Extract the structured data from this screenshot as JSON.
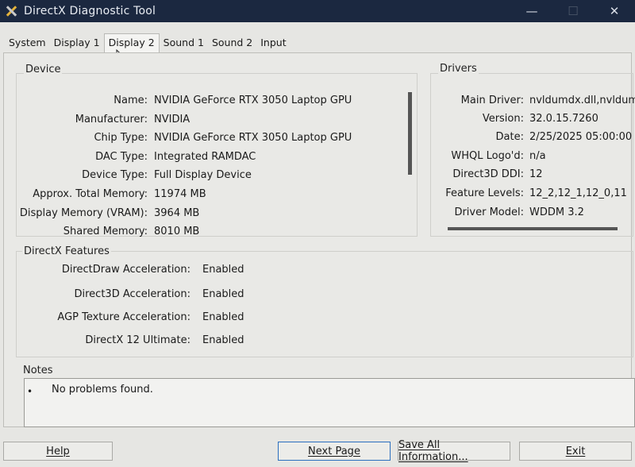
{
  "window": {
    "title": "DirectX Diagnostic Tool",
    "controls": [
      "—",
      "☐",
      "✕"
    ]
  },
  "tabs": [
    {
      "label": "System"
    },
    {
      "label": "Display 1"
    },
    {
      "label": "Display 2",
      "active": true
    },
    {
      "label": "Sound 1"
    },
    {
      "label": "Sound 2"
    },
    {
      "label": "Input"
    }
  ],
  "device": {
    "title": "Device",
    "rows": [
      {
        "label": "Name:",
        "value": "NVIDIA GeForce RTX 3050 Laptop GPU"
      },
      {
        "label": "Manufacturer:",
        "value": "NVIDIA"
      },
      {
        "label": "Chip Type:",
        "value": "NVIDIA GeForce RTX 3050 Laptop GPU"
      },
      {
        "label": "DAC Type:",
        "value": "Integrated RAMDAC"
      },
      {
        "label": "Device Type:",
        "value": "Full Display Device"
      },
      {
        "label": "Approx. Total Memory:",
        "value": "11974 MB"
      },
      {
        "label": "Display Memory (VRAM):",
        "value": "3964 MB"
      },
      {
        "label": "Shared Memory:",
        "value": "8010 MB"
      }
    ]
  },
  "drivers": {
    "title": "Drivers",
    "rows": [
      {
        "label": "Main Driver:",
        "value": "nvldumdx.dll,nvldum"
      },
      {
        "label": "Version:",
        "value": "32.0.15.7260"
      },
      {
        "label": "Date:",
        "value": "2/25/2025 05:00:00"
      },
      {
        "label": "WHQL Logo'd:",
        "value": "n/a"
      },
      {
        "label": "Direct3D DDI:",
        "value": "12"
      },
      {
        "label": "Feature Levels:",
        "value": "12_2,12_1,12_0,11"
      },
      {
        "label": "Driver Model:",
        "value": "WDDM 3.2"
      }
    ]
  },
  "features": {
    "title": "DirectX Features",
    "rows": [
      {
        "label": "DirectDraw Acceleration:",
        "value": "Enabled"
      },
      {
        "label": "Direct3D Acceleration:",
        "value": "Enabled"
      },
      {
        "label": "AGP Texture Acceleration:",
        "value": "Enabled"
      },
      {
        "label": "DirectX 12 Ultimate:",
        "value": "Enabled"
      }
    ]
  },
  "notes": {
    "title": "Notes",
    "items": [
      "No problems found."
    ]
  },
  "buttons": {
    "help": "Help",
    "next_page": "Next Page",
    "save_all": "Save All Information...",
    "exit": "Exit"
  }
}
